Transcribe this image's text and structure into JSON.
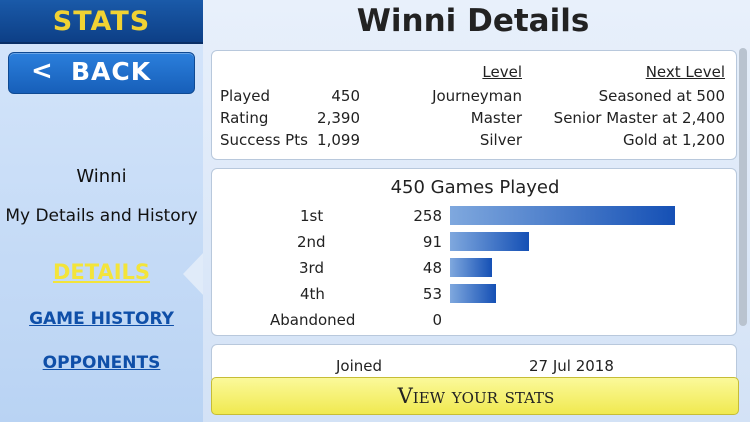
{
  "sidebar": {
    "title": "STATS",
    "back_arrow": "<",
    "back_label": "BACK",
    "user_name": "Winni",
    "user_subtitle": "My Details and History",
    "nav": {
      "details": "DETAILS",
      "game_history": "GAME HISTORY",
      "opponents": "OPPONENTS"
    },
    "active_color": "#f3e43a",
    "link_color": "#0f4fa8"
  },
  "main": {
    "title": "Winni Details",
    "levels": {
      "headers": {
        "level": "Level",
        "next_level": "Next Level"
      },
      "rows": [
        {
          "label": "Played",
          "value": "450",
          "level": "Journeyman",
          "next": "Seasoned at 500"
        },
        {
          "label": "Rating",
          "value": "2,390",
          "level": "Master",
          "next": "Senior Master at 2,400"
        },
        {
          "label": "Success Pts",
          "value": "1,099",
          "level": "Silver",
          "next": "Gold at 1,200"
        }
      ]
    },
    "games": {
      "title": "450 Games Played",
      "rows": [
        {
          "label": "1st",
          "count": "258",
          "share": 0.573
        },
        {
          "label": "2nd",
          "count": "91",
          "share": 0.202
        },
        {
          "label": "3rd",
          "count": "48",
          "share": 0.107
        },
        {
          "label": "4th",
          "count": "53",
          "share": 0.118
        },
        {
          "label": "Abandoned",
          "count": "0",
          "share": 0
        }
      ]
    },
    "joined": {
      "label": "Joined",
      "date": "27 Jul 2018"
    },
    "view_button": "View your stats"
  }
}
